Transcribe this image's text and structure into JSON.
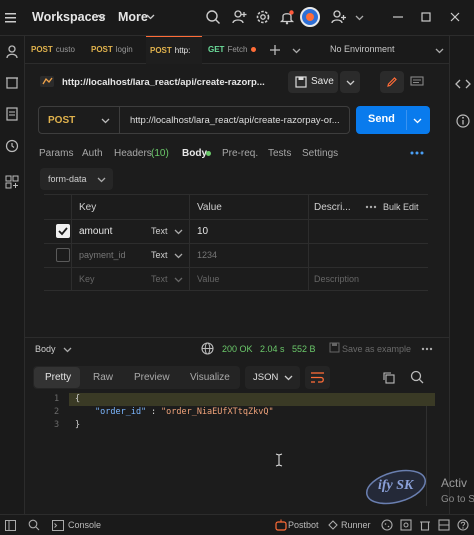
{
  "topbar": {
    "workspaces_label": "Workspaces",
    "more_label": "More"
  },
  "tabs": [
    {
      "method": "POST",
      "label": "custo"
    },
    {
      "method": "POST",
      "label": "login"
    },
    {
      "method": "POST",
      "label": "http:"
    },
    {
      "method": "GET",
      "label": "Fetch"
    }
  ],
  "environment": "No Environment",
  "request": {
    "title": "http://localhost/lara_react/api/create-razorp...",
    "save_label": "Save",
    "method": "POST",
    "url": "http://localhost/lara_react/api/create-razorpay-or...",
    "send_label": "Send"
  },
  "subtabs": {
    "params": "Params",
    "auth": "Auth",
    "headers": "Headers",
    "headers_count": "(10)",
    "body": "Body",
    "prereq": "Pre-req.",
    "tests": "Tests",
    "settings": "Settings"
  },
  "body_type": "form-data",
  "table": {
    "headers": {
      "key": "Key",
      "value": "Value",
      "description": "Descri...",
      "bulk_edit": "Bulk Edit"
    },
    "rows": [
      {
        "key": "amount",
        "type": "Text",
        "value": "10",
        "checked": true
      },
      {
        "key": "payment_id",
        "type": "Text",
        "value": "1234",
        "checked": false
      }
    ],
    "placeholder": {
      "key": "Key",
      "type": "Text",
      "value": "Value",
      "description": "Description"
    }
  },
  "response": {
    "label": "Body",
    "status": "200 OK",
    "time": "2.04 s",
    "size": "552 B",
    "save_example": "Save as example",
    "view_tabs": [
      "Pretty",
      "Raw",
      "Preview",
      "Visualize"
    ],
    "format": "JSON",
    "lines": [
      {
        "n": "1",
        "text": "{"
      },
      {
        "n": "2",
        "key": "\"order_id\"",
        "sep": ": ",
        "val": "\"order_NiaEUfXTtqZkvQ\""
      },
      {
        "n": "3",
        "text": "}"
      }
    ]
  },
  "watermark": {
    "logo_text": "ify SK",
    "activate_1": "Activ",
    "activate_2": "Go to S"
  },
  "statusbar": {
    "console": "Console",
    "postbot": "Postbot",
    "runner": "Runner"
  }
}
